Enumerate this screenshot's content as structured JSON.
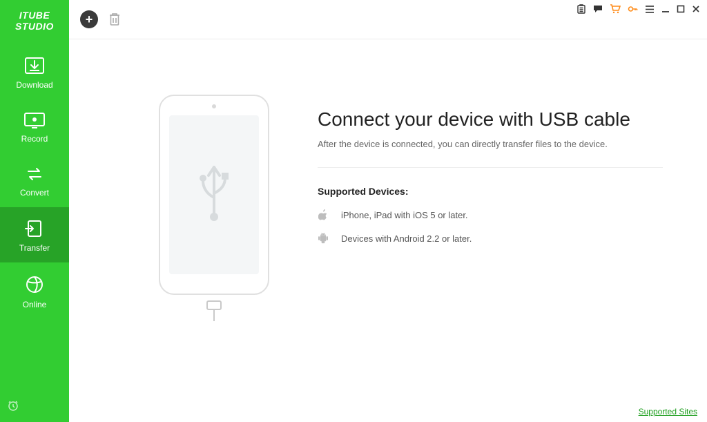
{
  "brand": "ITUBE STUDIO",
  "sidebar": {
    "items": [
      {
        "label": "Download"
      },
      {
        "label": "Record"
      },
      {
        "label": "Convert"
      },
      {
        "label": "Transfer"
      },
      {
        "label": "Online"
      }
    ],
    "active_index": 3
  },
  "main": {
    "headline": "Connect your device with USB cable",
    "subline": "After the device is connected, you can directly transfer files to the device.",
    "supported_title": "Supported Devices:",
    "support_ios": "iPhone, iPad with iOS 5 or later.",
    "support_android": "Devices with Android 2.2 or later."
  },
  "footer": {
    "supported_sites": "Supported Sites"
  }
}
